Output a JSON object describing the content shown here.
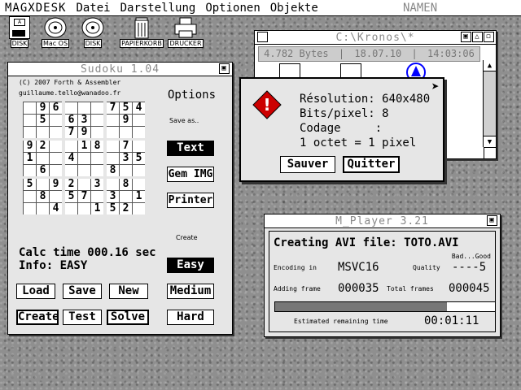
{
  "menubar": {
    "app": "MAGXDESK",
    "items": [
      "Datei",
      "Darstellung",
      "Optionen",
      "Objekte"
    ],
    "status": "NAMEN"
  },
  "desktop_icons": [
    {
      "label": "DISK",
      "icon": "floppy-icon"
    },
    {
      "label": "Mac OS",
      "icon": "cd-icon"
    },
    {
      "label": "DISK",
      "icon": "cd-icon"
    },
    {
      "label": "PAPIERKORB",
      "icon": "trash-icon"
    },
    {
      "label": "DRUCKER",
      "icon": "printer-icon"
    }
  ],
  "sudoku": {
    "title": "Sudoku 1.04",
    "credit1": "(C) 2007 Forth & Assembler",
    "credit2": "guillaume.tello@wanadoo.fr",
    "grid": [
      [
        "",
        "9",
        "6",
        "",
        "",
        "",
        "7",
        "5",
        "4"
      ],
      [
        "",
        "5",
        "",
        "6",
        "3",
        "",
        "",
        "9",
        ""
      ],
      [
        "",
        "",
        "",
        "7",
        "9",
        "",
        "",
        "",
        ""
      ],
      [
        "9",
        "2",
        "",
        "",
        "1",
        "8",
        "",
        "7",
        ""
      ],
      [
        "1",
        "",
        "",
        "4",
        "",
        "",
        "",
        "3",
        "5"
      ],
      [
        "",
        "6",
        "",
        "",
        "",
        "",
        "8",
        "",
        ""
      ],
      [
        "5",
        "",
        "9",
        "2",
        "",
        "3",
        "",
        "8",
        ""
      ],
      [
        "",
        "8",
        "",
        "5",
        "7",
        "",
        "3",
        "",
        "1"
      ],
      [
        "",
        "",
        "4",
        "",
        "",
        "1",
        "5",
        "2",
        ""
      ]
    ],
    "calc_time": "Calc time 000.16 sec",
    "info": "Info: EASY",
    "buttons": {
      "load": "Load",
      "save": "Save",
      "new": "New",
      "create": "Create",
      "test": "Test",
      "solve": "Solve"
    },
    "options_label": "Options",
    "save_as_label": "Save as..",
    "save_options": [
      "Text",
      "Gem IMG",
      "Printer"
    ],
    "create_label": "Create",
    "create_options": [
      "Easy",
      "Medium",
      "Hard"
    ]
  },
  "kronos": {
    "title": "C:\\Kronos\\*",
    "bytes": "4.782 Bytes",
    "date": "18.07.10",
    "time": "14:03:06"
  },
  "dialog": {
    "lines": [
      "Résolution: 640x480",
      "Bits/pixel: 8",
      "Codage     :",
      "1 octet = 1 pixel"
    ],
    "save_button": "Sauver",
    "quit_button": "Quitter"
  },
  "mplayer": {
    "title": "M_Player 3.21",
    "heading": "Creating AVI file: TOTO.AVI",
    "bad_good": "Bad...Good",
    "encoding_label": "Encoding in",
    "encoding_value": "MSVC16",
    "quality_label": "Quality",
    "quality_value": "----5",
    "adding_label": "Adding frame",
    "adding_value": "000035",
    "total_label": "Total frames",
    "total_value": "000045",
    "progress": 0.78,
    "remaining_label": "Estimated remaining time",
    "remaining_value": "00:01:11"
  }
}
